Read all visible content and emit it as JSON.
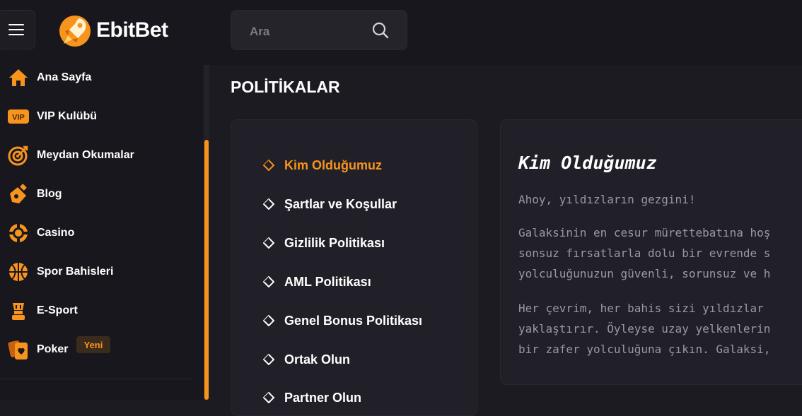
{
  "header": {
    "brand": "EbitBet",
    "search_placeholder": "Ara"
  },
  "sidebar": {
    "items": [
      {
        "label": "Ana Sayfa",
        "icon": "home-icon"
      },
      {
        "label": "VIP Kulübü",
        "icon": "vip-icon"
      },
      {
        "label": "Meydan Okumalar",
        "icon": "target-icon"
      },
      {
        "label": "Blog",
        "icon": "blog-icon"
      },
      {
        "label": "Casino",
        "icon": "casino-chip-icon"
      },
      {
        "label": "Spor Bahisleri",
        "icon": "basketball-icon"
      },
      {
        "label": "E-Sport",
        "icon": "esport-icon"
      },
      {
        "label": "Poker",
        "icon": "poker-cards-icon"
      }
    ],
    "poker_badge": "Yeni"
  },
  "page": {
    "title": "POLİTİKALAR"
  },
  "policy_nav": {
    "items": [
      {
        "label": "Kim Olduğumuz",
        "active": true
      },
      {
        "label": "Şartlar ve Koşullar",
        "active": false
      },
      {
        "label": "Gizlilik Politikası",
        "active": false
      },
      {
        "label": "AML Politikası",
        "active": false
      },
      {
        "label": "Genel Bonus Politikası",
        "active": false
      },
      {
        "label": "Ortak Olun",
        "active": false
      },
      {
        "label": "Partner Olun",
        "active": false
      }
    ]
  },
  "content": {
    "title": "Kim Olduğumuz",
    "intro": "Ahoy, yıldızların gezgini!",
    "para1": [
      "Galaksinin en cesur mürettebatına hoş",
      "sonsuz fırsatlarla dolu bir evrende s",
      "yolculuğunuzun güvenli, sorunsuz ve h"
    ],
    "para2": [
      "Her çevrim, her bahis sizi yıldızlar",
      "yaklaştırır. Öyleyse uzay yelkenlerin",
      "bir zafer yolculuğuna çıkın. Galaksi,"
    ]
  },
  "colors": {
    "accent": "#f7941d",
    "background": "#1c1b22",
    "panel": "#212028"
  }
}
